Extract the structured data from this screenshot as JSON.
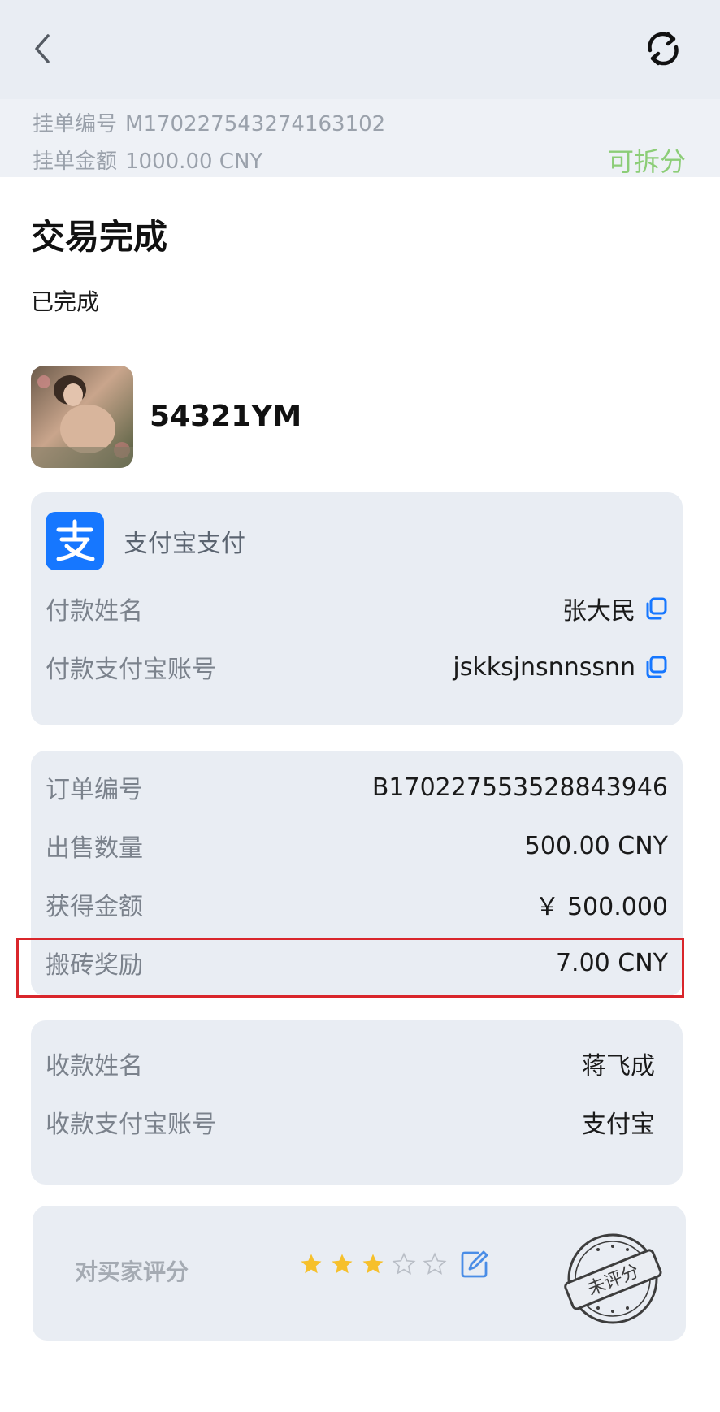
{
  "header": {
    "back_icon": "chevron-left-icon",
    "refresh_icon": "refresh-icon",
    "order_no_label": "挂单编号",
    "order_no": "M170227543274163102",
    "order_amount_label": "挂单金额",
    "order_amount": "1000.00 CNY",
    "split_status": "可拆分"
  },
  "title": "交易完成",
  "status": "已完成",
  "seller": {
    "name": "54321YM"
  },
  "payment": {
    "method": "支付宝支付",
    "payer_name_label": "付款姓名",
    "payer_name": "张大民",
    "payer_account_label": "付款支付宝账号",
    "payer_account": "jskksjnsnnssnn"
  },
  "order": {
    "order_id_label": "订单编号",
    "order_id": "B170227553528843946",
    "sell_qty_label": "出售数量",
    "sell_qty": "500.00 CNY",
    "received_label": "获得金额",
    "received": "￥ 500.000",
    "reward_label": "搬砖奖励",
    "reward": "7.00 CNY"
  },
  "receiver": {
    "name_label": "收款姓名",
    "name": "蒋飞成",
    "account_label": "收款支付宝账号",
    "account": "支付宝"
  },
  "rating": {
    "label": "对买家评分",
    "stars_filled": 3,
    "stars_total": 5,
    "stamp_text": "未评分"
  },
  "colors": {
    "accent_green": "#8ccd77",
    "alipay_blue": "#1677ff",
    "star_gold": "#f6c02b",
    "highlight_red": "#d9262b"
  }
}
